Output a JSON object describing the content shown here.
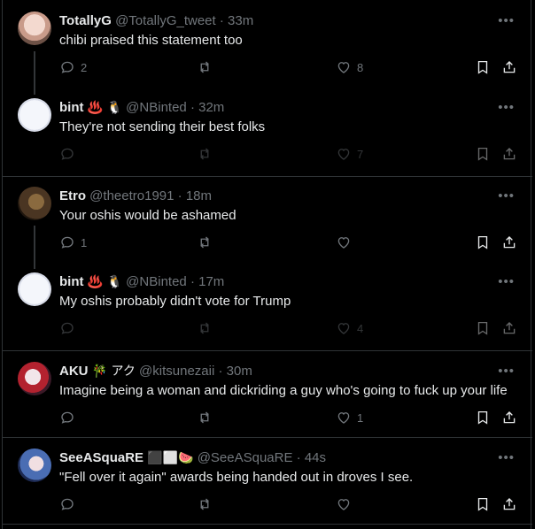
{
  "colors": {
    "background": "#000000",
    "text": "#e7e9ea",
    "muted": "#71767b",
    "divider": "#2f3336"
  },
  "threads": [
    {
      "posts": [
        {
          "name": "TotallyG",
          "emoji": "",
          "handle": "@TotallyG_tweet",
          "time": "33m",
          "text": "chibi praised this statement too",
          "replies": "2",
          "retweets": "",
          "likes": "8",
          "avatar": "anime-girl-pink"
        },
        {
          "name": "bint",
          "emoji": "♨️ 🐧",
          "handle": "@NBinted",
          "time": "32m",
          "text": "They're not sending their best folks",
          "replies": "",
          "retweets": "",
          "likes": "7",
          "avatar": "anime-face-white"
        }
      ]
    },
    {
      "posts": [
        {
          "name": "Etro",
          "emoji": "",
          "handle": "@theetro1991",
          "time": "18m",
          "text": "Your oshis would be ashamed",
          "replies": "1",
          "retweets": "",
          "likes": "",
          "avatar": "brown-photo"
        },
        {
          "name": "bint",
          "emoji": "♨️ 🐧",
          "handle": "@NBinted",
          "time": "17m",
          "text": "My oshis probably didn't vote for Trump",
          "replies": "",
          "retweets": "",
          "likes": "4",
          "avatar": "anime-face-white"
        }
      ]
    },
    {
      "posts": [
        {
          "name": "AKU",
          "emoji": "🎋 アク",
          "handle": "@kitsunezaii",
          "time": "30m",
          "text": "Imagine being a woman and dickriding a guy who's going to fuck up your life",
          "replies": "",
          "retweets": "",
          "likes": "1",
          "avatar": "anime-red-hair"
        }
      ]
    },
    {
      "posts": [
        {
          "name": "SeeASquaRE",
          "emoji": "⬛⬜🍉",
          "handle": "@SeeASquaRE",
          "time": "44s",
          "text": "\"Fell over it again\" awards being handed out in droves I see.",
          "replies": "",
          "retweets": "",
          "likes": "",
          "avatar": "anime-blue-hair"
        }
      ]
    }
  ]
}
